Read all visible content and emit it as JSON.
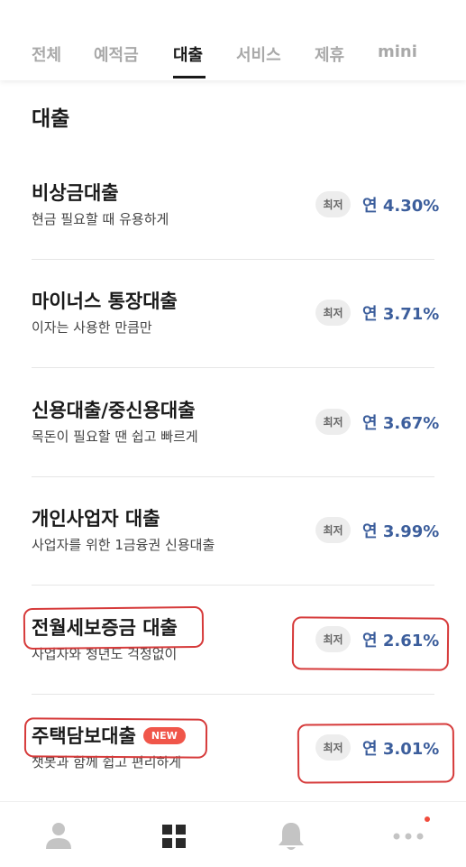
{
  "tabs": [
    {
      "label": "전체",
      "active": false
    },
    {
      "label": "예적금",
      "active": false
    },
    {
      "label": "대출",
      "active": true
    },
    {
      "label": "서비스",
      "active": false
    },
    {
      "label": "제휴",
      "active": false
    },
    {
      "label": "mini",
      "active": false
    }
  ],
  "section": {
    "title": "대출"
  },
  "products": [
    {
      "name": "비상금대출",
      "desc": "현금 필요할 때 유용하게",
      "badge": "최저",
      "rate": "연 4.30%"
    },
    {
      "name": "마이너스 통장대출",
      "desc": "이자는 사용한 만큼만",
      "badge": "최저",
      "rate": "연 3.71%"
    },
    {
      "name": "신용대출/중신용대출",
      "desc": "목돈이 필요할 땐 쉽고 빠르게",
      "badge": "최저",
      "rate": "연 3.67%"
    },
    {
      "name": "개인사업자 대출",
      "desc": "사업자를 위한 1금융권 신용대출",
      "badge": "최저",
      "rate": "연 3.99%"
    },
    {
      "name": "전월세보증금 대출",
      "desc": "사업자와 청년도 걱정없이",
      "badge": "최저",
      "rate": "연 2.61%"
    },
    {
      "name": "주택담보대출",
      "desc": "챗봇과 함께 쉽고 편리하게",
      "badge": "최저",
      "rate": "연 3.01%",
      "new_label": "NEW"
    }
  ],
  "colors": {
    "rate": "#3c5e9c",
    "new_badge": "#f0564a",
    "annotation": "#d63a3a"
  },
  "bottom_nav": [
    {
      "icon": "person-icon"
    },
    {
      "icon": "grid-icon"
    },
    {
      "icon": "bell-icon"
    },
    {
      "icon": "more-dots-icon",
      "notification_dot": true
    }
  ]
}
